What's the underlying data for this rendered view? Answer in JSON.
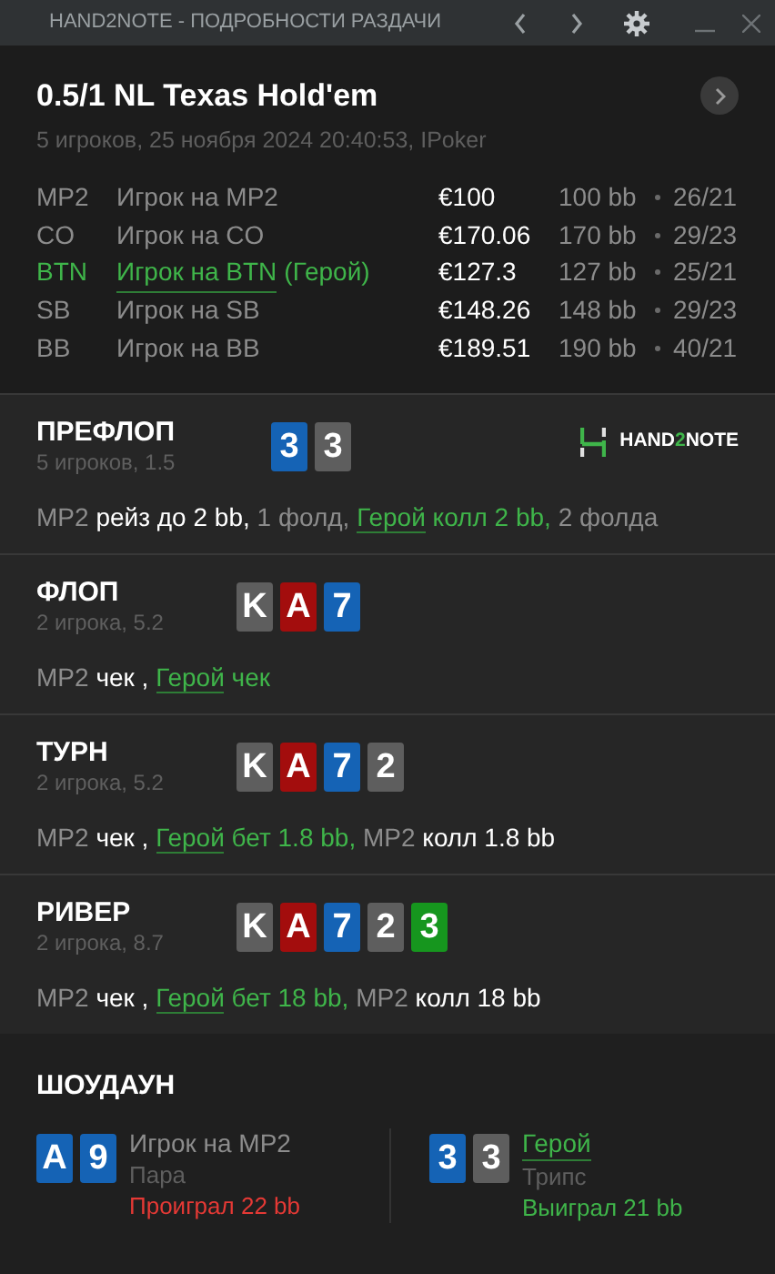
{
  "window": {
    "title": "HAND2NOTE - ПОДРОБНОСТИ РАЗДАЧИ"
  },
  "hand": {
    "title": "0.5/1 NL Texas Hold'em",
    "subtitle": "5 игроков, 25 ноября 2024 20:40:53, IPoker"
  },
  "players": [
    {
      "position": "MP2",
      "name": "Игрок на MP2",
      "hero": false,
      "stack": "€100",
      "bb": "100 bb",
      "stats": "26/21"
    },
    {
      "position": "CO",
      "name": "Игрок на CO",
      "hero": false,
      "stack": "€170.06",
      "bb": "170 bb",
      "stats": "29/23"
    },
    {
      "position": "BTN",
      "name": "Игрок на BTN",
      "tag": "(Герой)",
      "hero": true,
      "stack": "€127.3",
      "bb": "127 bb",
      "stats": "25/21"
    },
    {
      "position": "SB",
      "name": "Игрок на SB",
      "hero": false,
      "stack": "€148.26",
      "bb": "148 bb",
      "stats": "29/23"
    },
    {
      "position": "BB",
      "name": "Игрок на BB",
      "hero": false,
      "stack": "€189.51",
      "bb": "190 bb",
      "stats": "40/21"
    }
  ],
  "streets": [
    {
      "name": "ПРЕФЛОП",
      "info": "5 игроков, 1.5",
      "logo": [
        {
          "text": "HAND",
          "accent": false
        },
        {
          "text": "2",
          "accent": true
        },
        {
          "text": "NOTE",
          "accent": false
        }
      ],
      "cards": [
        {
          "rank": "3",
          "color": "#1563b5"
        },
        {
          "rank": "3",
          "color": "#5e5e5e"
        }
      ],
      "actions": [
        {
          "text": "MP2",
          "kind": "player"
        },
        {
          "text": "рейз до 2 bb,",
          "kind": "action"
        },
        {
          "text": "1 фолд,",
          "kind": "player"
        },
        {
          "text": "Герой",
          "kind": "hero"
        },
        {
          "text": "колл 2 bb,",
          "kind": "hero_action"
        },
        {
          "text": "2 фолда",
          "kind": "player"
        }
      ]
    },
    {
      "name": "ФЛОП",
      "info": "2 игрока, 5.2",
      "cards": [
        {
          "rank": "K",
          "color": "#5e5e5e"
        },
        {
          "rank": "A",
          "color": "#a30d0d"
        },
        {
          "rank": "7",
          "color": "#1563b5"
        }
      ],
      "actions": [
        {
          "text": "MP2",
          "kind": "player"
        },
        {
          "text": "чек ,",
          "kind": "action"
        },
        {
          "text": "Герой",
          "kind": "hero"
        },
        {
          "text": "чек",
          "kind": "hero_action"
        }
      ]
    },
    {
      "name": "ТУРН",
      "info": "2 игрока, 5.2",
      "cards": [
        {
          "rank": "K",
          "color": "#5e5e5e"
        },
        {
          "rank": "A",
          "color": "#a30d0d"
        },
        {
          "rank": "7",
          "color": "#1563b5"
        },
        {
          "rank": "2",
          "color": "#5e5e5e"
        }
      ],
      "actions": [
        {
          "text": "MP2",
          "kind": "player"
        },
        {
          "text": "чек ,",
          "kind": "action"
        },
        {
          "text": "Герой",
          "kind": "hero"
        },
        {
          "text": "бет 1.8 bb,",
          "kind": "hero_action"
        },
        {
          "text": "MP2",
          "kind": "player"
        },
        {
          "text": "колл 1.8 bb",
          "kind": "action"
        }
      ]
    },
    {
      "name": "РИВЕР",
      "info": "2 игрока, 8.7",
      "cards": [
        {
          "rank": "K",
          "color": "#5e5e5e"
        },
        {
          "rank": "A",
          "color": "#a30d0d"
        },
        {
          "rank": "7",
          "color": "#1563b5"
        },
        {
          "rank": "2",
          "color": "#5e5e5e"
        },
        {
          "rank": "3",
          "color": "#16961e"
        }
      ],
      "actions": [
        {
          "text": "MP2",
          "kind": "player"
        },
        {
          "text": "чек ,",
          "kind": "action"
        },
        {
          "text": "Герой",
          "kind": "hero"
        },
        {
          "text": "бет 18 bb,",
          "kind": "hero_action"
        },
        {
          "text": "MP2",
          "kind": "player"
        },
        {
          "text": "колл 18 bb",
          "kind": "action"
        }
      ]
    }
  ],
  "showdown": {
    "title": "ШОУДАУН",
    "hands": [
      {
        "name": "Игрок на MP2",
        "hero": false,
        "combination": "Пара",
        "result": "Проиграл 22 bb",
        "won": false,
        "cards": [
          {
            "rank": "A",
            "color": "#1563b5"
          },
          {
            "rank": "9",
            "color": "#1563b5"
          }
        ]
      },
      {
        "name": "Герой",
        "hero": true,
        "combination": "Трипс",
        "result": "Выиграл 21 bb",
        "won": true,
        "cards": [
          {
            "rank": "3",
            "color": "#1563b5"
          },
          {
            "rank": "3",
            "color": "#5e5e5e"
          }
        ]
      }
    ]
  }
}
